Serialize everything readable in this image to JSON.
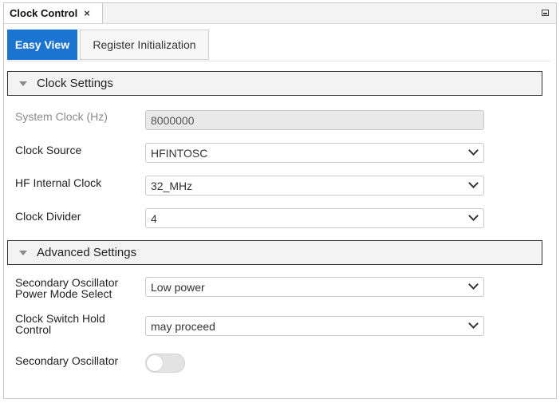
{
  "window": {
    "tab_title": "Clock Control",
    "close_glyph": "×"
  },
  "tabs": [
    {
      "label": "Easy View",
      "active": true
    },
    {
      "label": "Register Initialization",
      "active": false
    }
  ],
  "sections": {
    "clock": {
      "title": "Clock Settings",
      "expanded": true
    },
    "advanced": {
      "title": "Advanced Settings",
      "expanded": true
    }
  },
  "clock_settings": {
    "system_clock": {
      "label": "System Clock (Hz)",
      "value": "8000000",
      "editable": false
    },
    "clock_source": {
      "label": "Clock Source",
      "value": "HFINTOSC"
    },
    "hf_internal_clock": {
      "label": "HF Internal Clock",
      "value": "32_MHz"
    },
    "clock_divider": {
      "label": "Clock Divider",
      "value": "4"
    }
  },
  "advanced_settings": {
    "secondary_osc_power": {
      "label_line1": "Secondary Oscillator",
      "label_line2": "Power Mode Select",
      "value": "Low power"
    },
    "clock_switch_hold": {
      "label_line1": "Clock Switch Hold",
      "label_line2": "Control",
      "value": "may proceed"
    },
    "secondary_oscillator": {
      "label": "Secondary Oscillator",
      "enabled": false
    }
  },
  "colors": {
    "accent": "#1a74d0",
    "section_border": "#333333",
    "disabled_text": "#8a8a8a"
  },
  "icons": {
    "close": "close-icon",
    "minimize": "minimize-icon",
    "section_toggle": "triangle-down-icon",
    "dropdown": "chevron-down-icon"
  }
}
